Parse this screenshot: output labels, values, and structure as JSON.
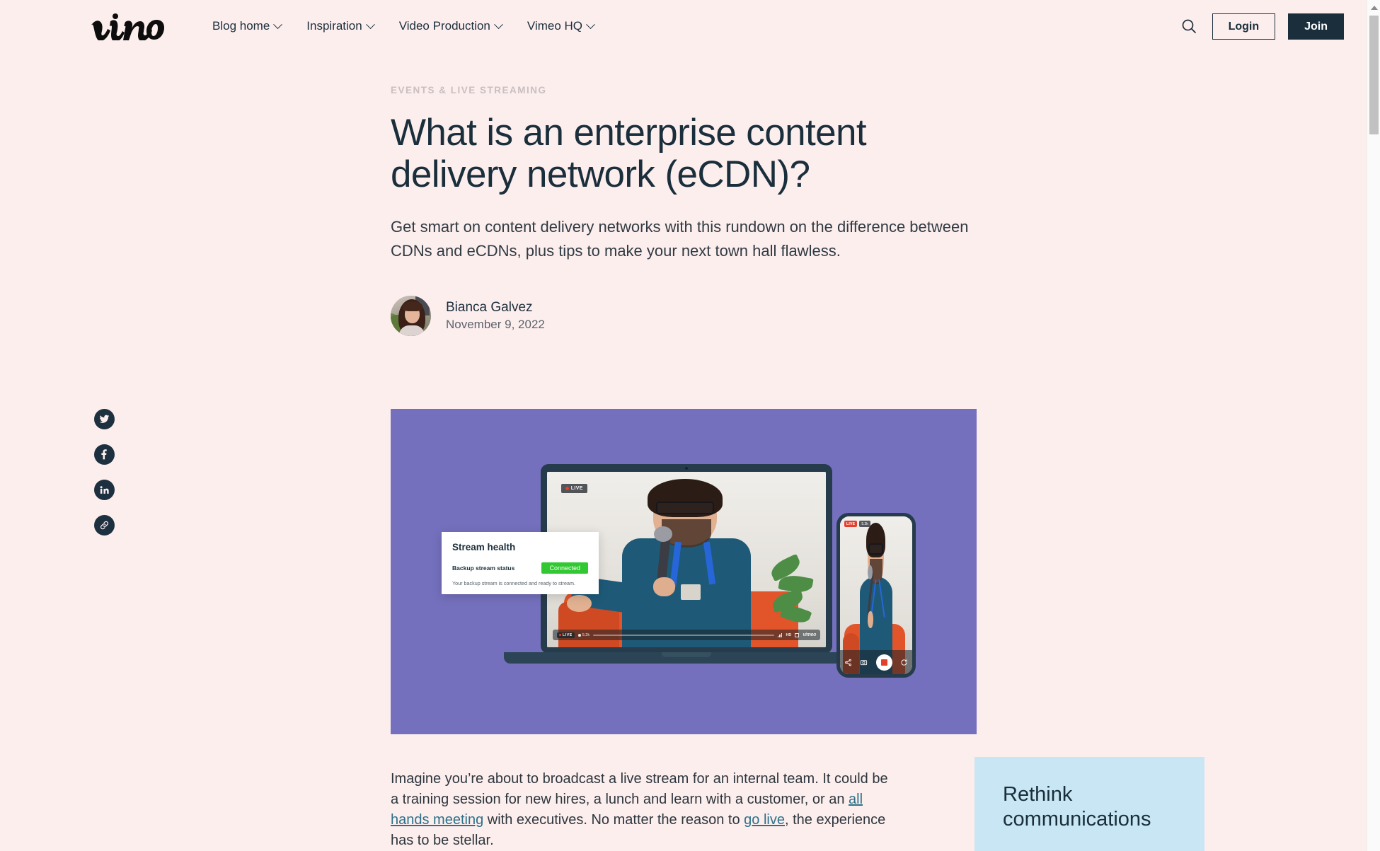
{
  "site": {
    "logo_text": "vimeo"
  },
  "header": {
    "nav": [
      {
        "label": "Blog home",
        "has_caret": true
      },
      {
        "label": "Inspiration",
        "has_caret": true
      },
      {
        "label": "Video Production",
        "has_caret": true
      },
      {
        "label": "Vimeo HQ",
        "has_caret": true
      }
    ],
    "search_icon": "search-icon",
    "login_label": "Login",
    "join_label": "Join"
  },
  "share": {
    "items": [
      {
        "name": "twitter-icon",
        "label": "Share on Twitter"
      },
      {
        "name": "facebook-icon",
        "label": "Share on Facebook"
      },
      {
        "name": "linkedin-icon",
        "label": "Share on LinkedIn"
      },
      {
        "name": "link-icon",
        "label": "Copy link"
      }
    ]
  },
  "article": {
    "kicker": "EVENTS & LIVE STREAMING",
    "title": "What is an enterprise content delivery network (eCDN)?",
    "dek": "Get smart on content delivery networks with this rundown on the difference between CDNs and eCDNs, plus tips to make your next town hall flawless.",
    "author_name": "Bianca Galvez",
    "published_date": "November 9, 2022",
    "body_paragraph_parts": {
      "p1": "Imagine you’re about to broadcast a live stream for an internal team. It could be a training session for new hires, a lunch and learn with a customer, or an ",
      "link1": "all hands meeting",
      "p2": " with executives. No matter the reason to ",
      "link2": "go live",
      "p3": ", the experience has to be stellar."
    }
  },
  "hero": {
    "background_color": "#7470bd",
    "laptop_live_badge": "LIVE",
    "player": {
      "live_label": "LIVE",
      "viewer_count": "5.2k",
      "quality_label": "HD",
      "brand": "vimeo"
    },
    "phone": {
      "live_label": "LIVE",
      "viewer_count": "5.2k"
    },
    "stream_health_card": {
      "title": "Stream health",
      "row_label": "Backup stream status",
      "status": "Connected",
      "status_color": "#32c832",
      "note": "Your backup stream is connected and ready to stream."
    }
  },
  "promo": {
    "title": "Rethink communications",
    "background_color": "#c9e6f4"
  },
  "scrollbar": {
    "up_arrow": "scroll-up-arrow"
  }
}
